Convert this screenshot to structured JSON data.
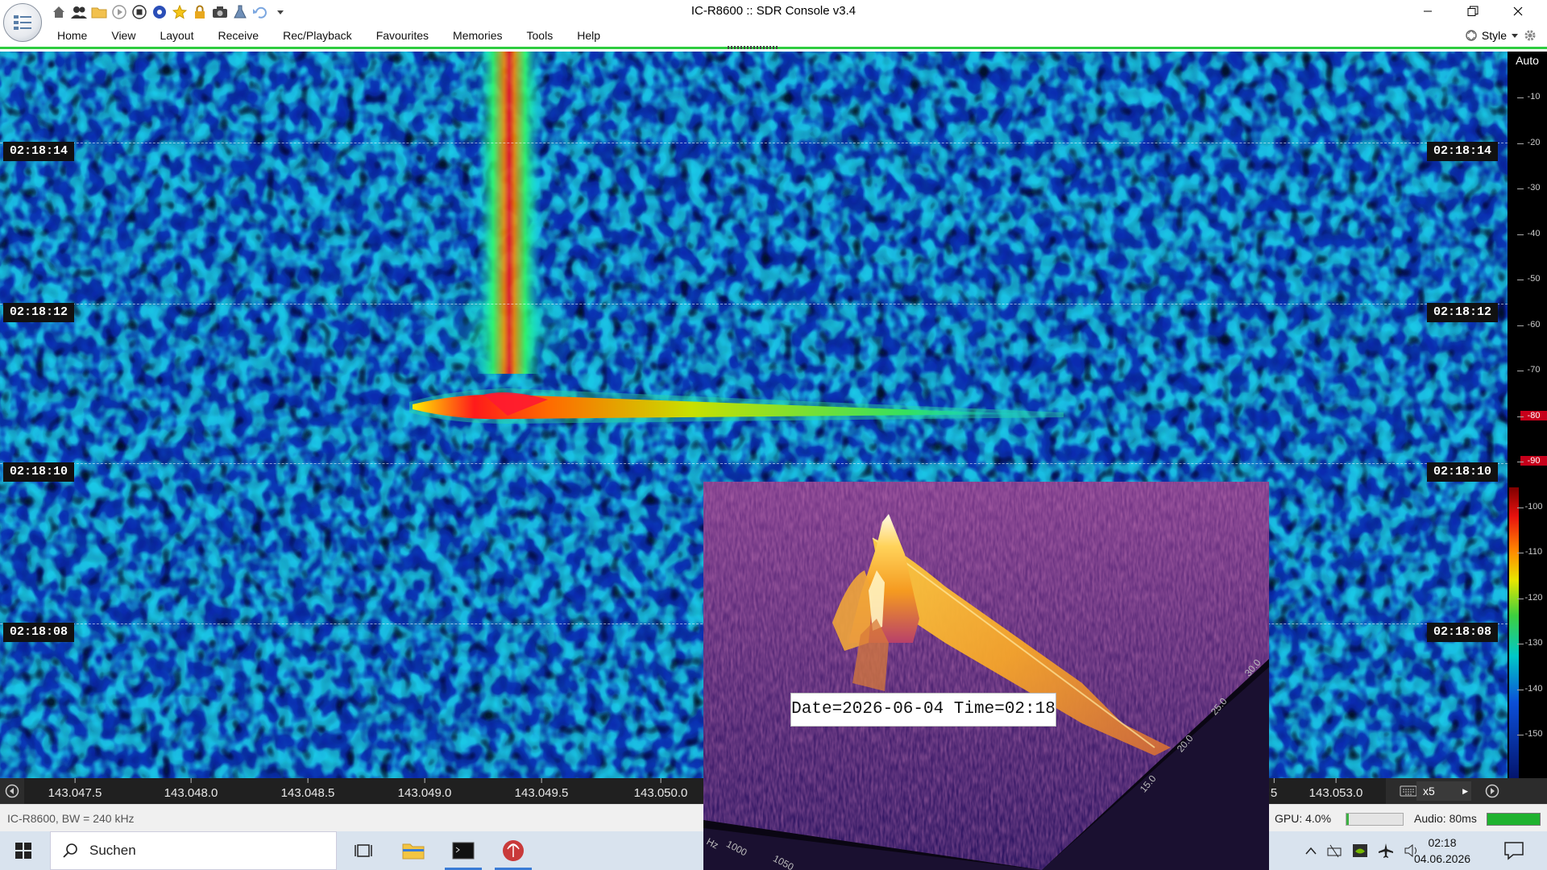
{
  "window": {
    "title": "IC-R8600 :: SDR Console v3.4"
  },
  "quick_access": [
    "home-icon",
    "users-icon",
    "folder-icon",
    "play-icon",
    "stop-icon",
    "record-icon",
    "star-icon",
    "lock-icon",
    "camera-icon",
    "flask-icon",
    "undo-icon",
    "dropdown-icon"
  ],
  "menu": {
    "items": [
      "Home",
      "View",
      "Layout",
      "Receive",
      "Rec/Playback",
      "Favourites",
      "Memories",
      "Tools",
      "Help"
    ],
    "style_label": "Style"
  },
  "scale": {
    "auto_label": "Auto",
    "ticks": [
      "-10",
      "-20",
      "-30",
      "-40",
      "-50",
      "-60",
      "-70",
      "-80",
      "-90",
      "-100",
      "-110",
      "-120",
      "-130",
      "-140",
      "-150"
    ],
    "highlight_ticks": [
      "-80",
      "-90"
    ]
  },
  "waterfall": {
    "time_labels": [
      "02:18:14",
      "02:18:12",
      "02:18:10",
      "02:18:08"
    ]
  },
  "frequency": {
    "ticks": [
      "143.047.5",
      "143.048.0",
      "143.048.5",
      "143.049.0",
      "143.049.5",
      "143.050.0",
      "5",
      "143.053.0"
    ],
    "span": "x5"
  },
  "overlay": {
    "date_text": "Date=2026-06-04 Time=02:18",
    "axis_time": [
      "30.0",
      "25.0",
      "20.0",
      "15.0"
    ],
    "axis_freq": [
      "Hz",
      "1000",
      "1050"
    ]
  },
  "status": {
    "left": "IC-R8600, BW = 240 kHz",
    "gpu": "GPU: 4.0%",
    "gpu_level": 0.04,
    "audio": "Audio: 80ms",
    "audio_level": 1.0
  },
  "taskbar": {
    "search": "Suchen",
    "time": "02:18",
    "date": "04.06.2026"
  },
  "colors": {
    "accent_green": "#2ecc40",
    "taskbar": "#d9e3ee"
  }
}
